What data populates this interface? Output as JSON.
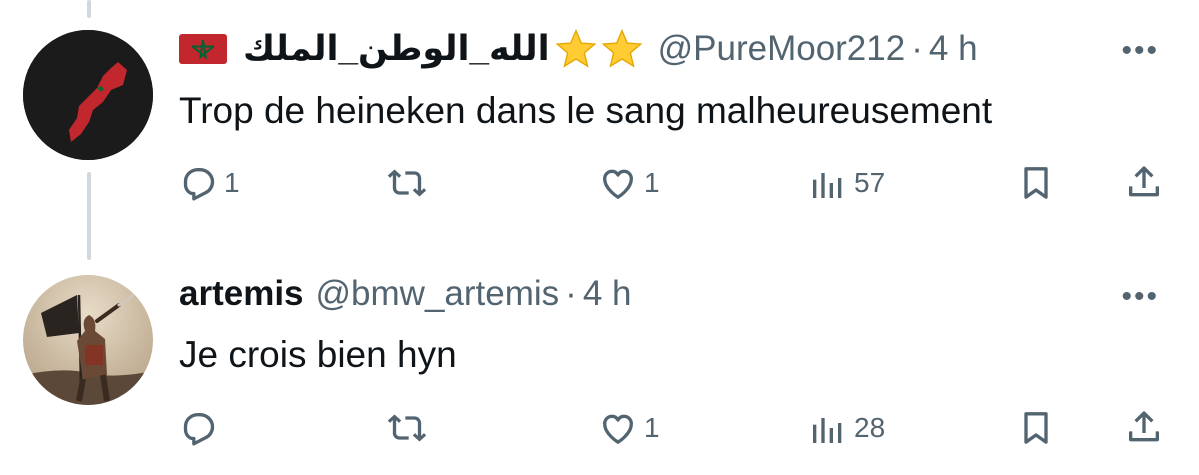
{
  "tweets": [
    {
      "name": "الله_الوطن_الملك",
      "handle": "@PureMoor212",
      "separator": "·",
      "time": "4 h",
      "text": "Trop de heineken dans le sang malheureusement",
      "replies": "1",
      "retweets": "",
      "likes": "1",
      "views": "57",
      "icons": [
        "morocco-flag-icon",
        "star-icon",
        "star-icon"
      ]
    },
    {
      "name": "artemis",
      "handle": "@bmw_artemis",
      "separator": "·",
      "time": "4 h",
      "text": "Je crois bien hyn",
      "replies": "",
      "retweets": "",
      "likes": "1",
      "views": "28"
    }
  ],
  "more_label": "•••",
  "colors": {
    "text": "#0f1419",
    "secondary": "#536471",
    "thread_line": "#cfd9de",
    "flag_red": "#c1272d",
    "flag_green": "#006233",
    "star": "#ffcc33"
  }
}
